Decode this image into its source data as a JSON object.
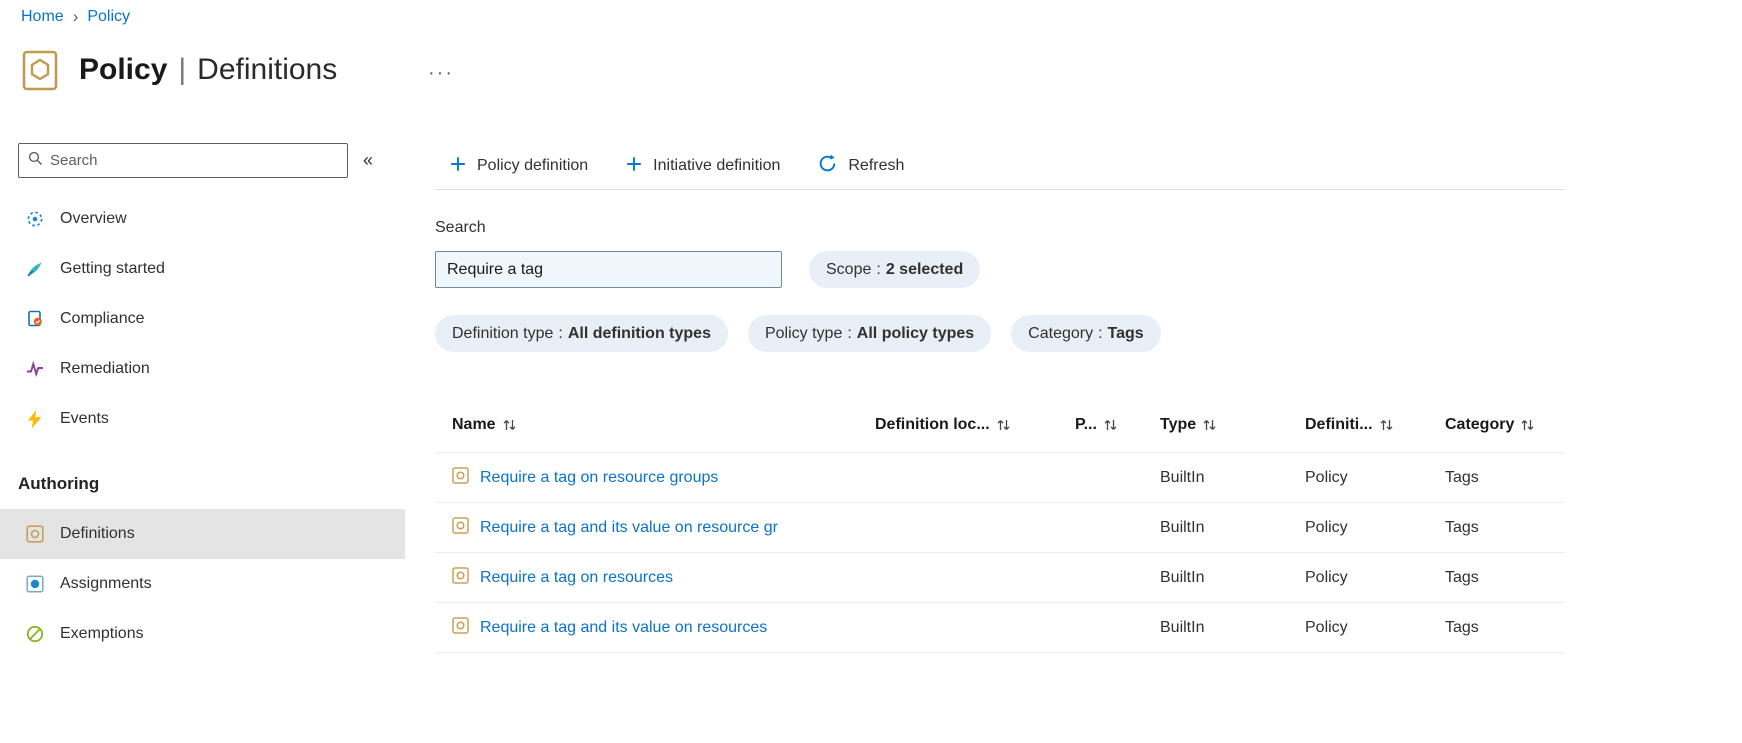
{
  "breadcrumb": {
    "separator": "›",
    "items": [
      {
        "label": "Home"
      },
      {
        "label": "Policy"
      }
    ]
  },
  "header": {
    "title_primary": "Policy",
    "title_separator": "|",
    "title_secondary": "Definitions",
    "more_glyph": "···"
  },
  "sidebar": {
    "search_placeholder": "Search",
    "collapse_glyph": "«",
    "items": [
      {
        "label": "Overview",
        "icon": "overview-icon"
      },
      {
        "label": "Getting started",
        "icon": "getting-started-icon"
      },
      {
        "label": "Compliance",
        "icon": "compliance-icon"
      },
      {
        "label": "Remediation",
        "icon": "remediation-icon"
      },
      {
        "label": "Events",
        "icon": "events-icon"
      }
    ],
    "section_heading": "Authoring",
    "authoring_items": [
      {
        "label": "Definitions",
        "icon": "definitions-icon",
        "selected": true
      },
      {
        "label": "Assignments",
        "icon": "assignments-icon",
        "selected": false
      },
      {
        "label": "Exemptions",
        "icon": "exemptions-icon",
        "selected": false
      }
    ]
  },
  "toolbar": {
    "buttons": [
      {
        "label": "Policy definition",
        "icon": "plus-icon"
      },
      {
        "label": "Initiative definition",
        "icon": "plus-icon"
      },
      {
        "label": "Refresh",
        "icon": "refresh-icon"
      }
    ]
  },
  "filters": {
    "search_label": "Search",
    "search_value": "Require a tag",
    "pill_separator": ":",
    "pills": [
      {
        "label": "Scope",
        "value": "2 selected"
      },
      {
        "label": "Definition type",
        "value": "All definition types"
      },
      {
        "label": "Policy type",
        "value": "All policy types"
      },
      {
        "label": "Category",
        "value": "Tags"
      }
    ]
  },
  "table": {
    "columns": [
      "Name",
      "Definition loc...",
      "P...",
      "Type",
      "Definiti...",
      "Category"
    ],
    "rows": [
      {
        "name": "Require a tag on resource groups",
        "definition_location": "",
        "policies": "",
        "type": "BuiltIn",
        "definition_type": "Policy",
        "category": "Tags"
      },
      {
        "name": "Require a tag and its value on resource gr",
        "definition_location": "",
        "policies": "",
        "type": "BuiltIn",
        "definition_type": "Policy",
        "category": "Tags"
      },
      {
        "name": "Require a tag on resources",
        "definition_location": "",
        "policies": "",
        "type": "BuiltIn",
        "definition_type": "Policy",
        "category": "Tags"
      },
      {
        "name": "Require a tag and its value on resources",
        "definition_location": "",
        "policies": "",
        "type": "BuiltIn",
        "definition_type": "Policy",
        "category": "Tags"
      }
    ]
  },
  "colors": {
    "accent_blue": "#0078d4",
    "link_blue": "#0b72c9",
    "pill_background": "#e8eff7",
    "search_value_background": "#eff6fc",
    "selected_item_background": "#e4e4e4",
    "policy_icon_tan": "#c8a057",
    "events_yellow": "#ffb900"
  }
}
